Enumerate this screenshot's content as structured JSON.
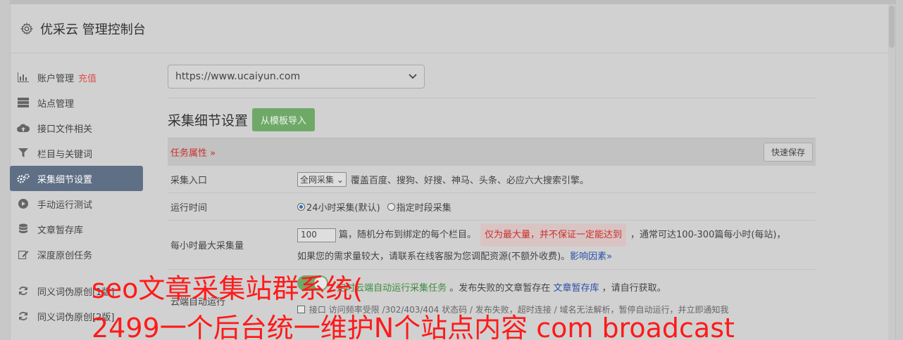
{
  "header": {
    "title": "优采云 管理控制台",
    "icon": "gear-icon"
  },
  "sidebar": {
    "items": [
      {
        "label": "账户管理",
        "badge": "充值",
        "icon": "bar-chart-icon"
      },
      {
        "label": "站点管理",
        "icon": "server-icon"
      },
      {
        "label": "接口文件相关",
        "icon": "cloud-upload-icon"
      },
      {
        "label": "栏目与关键词",
        "icon": "filter-icon"
      },
      {
        "label": "采集细节设置",
        "icon": "gears-icon",
        "active": true
      },
      {
        "label": "手动运行测试",
        "icon": "play-circle-icon"
      },
      {
        "label": "文章暂存库",
        "icon": "database-icon"
      },
      {
        "label": "深度原创任务",
        "icon": "edit-icon"
      },
      {
        "label": "同义词伪原创[1版]",
        "icon": "refresh-icon"
      },
      {
        "label": "同义词伪原创[2版]",
        "icon": "refresh-icon"
      }
    ]
  },
  "site_select": {
    "value": "https://www.ucaiyun.com"
  },
  "section": {
    "title": "采集细节设置",
    "import_button": "从模板导入"
  },
  "task_bar": {
    "label": "任务属性 »",
    "save_button": "快速保存"
  },
  "rows": {
    "entry": {
      "label": "采集入口",
      "select_value": "全网采集",
      "desc": "覆盖百度、搜狗、好搜、神马、头条、必应六大搜索引擎。"
    },
    "time": {
      "label": "运行时间",
      "opt1": "24小时采集(默认)",
      "opt2": "指定时段采集"
    },
    "max": {
      "label": "每小时最大采集量",
      "value": "100",
      "text1": "篇，随机分布到绑定的每个栏目。",
      "warn": "仅为最大量，并不保证一定能达到",
      "text2": "，通常可达100-300篇每小时(每站)，",
      "text3": "如果您的需求量较大，请联系在线客服为您调配资源(不额外收费)。",
      "link": "影响因素»"
    },
    "cloud": {
      "label": "云端自动运行",
      "text1": "定时云端自动运行采集任务",
      "text2": "。发布失败的文章暂存在",
      "link": "文章暂存库",
      "text3": "，请自行获取。",
      "line2": "接口 访问频率受限 /302/403/404 状态码 / 发布失败，超时连接 / 域名无法解析，暂停自动运行，并立即通知我"
    }
  },
  "overlay": {
    "line1": "seo文章采集站群系统(",
    "line2": "2499一个后台统一维护N个站点内容 com broadcast"
  }
}
